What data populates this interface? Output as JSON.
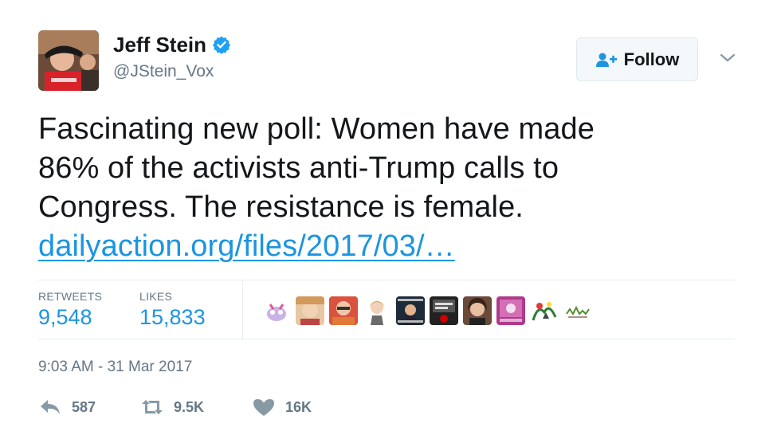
{
  "user": {
    "display_name": "Jeff Stein",
    "handle": "@JStein_Vox",
    "verified": true,
    "avatar_icon": "profile-photo"
  },
  "follow_button": {
    "label": "Follow",
    "icon": "add-person-icon"
  },
  "menu": {
    "icon": "chevron-down-icon"
  },
  "tweet": {
    "lines": [
      "Fascinating new poll: Women have made",
      "86% of the activists anti-Trump calls to",
      "Congress. The resistance is female."
    ],
    "link": "dailyaction.org/files/2017/03/…"
  },
  "stats": {
    "retweets_label": "RETWEETS",
    "retweets_value": "9,548",
    "likes_label": "LIKES",
    "likes_value": "15,833",
    "liker_count": 10
  },
  "timestamp": "9:03 AM - 31 Mar 2017",
  "actions": {
    "reply_count": "587",
    "retweet_count": "9.5K",
    "like_count": "16K"
  },
  "colors": {
    "accent": "#1b95e0",
    "muted": "#657786",
    "text": "#14171a",
    "border": "#e6ecf0"
  }
}
